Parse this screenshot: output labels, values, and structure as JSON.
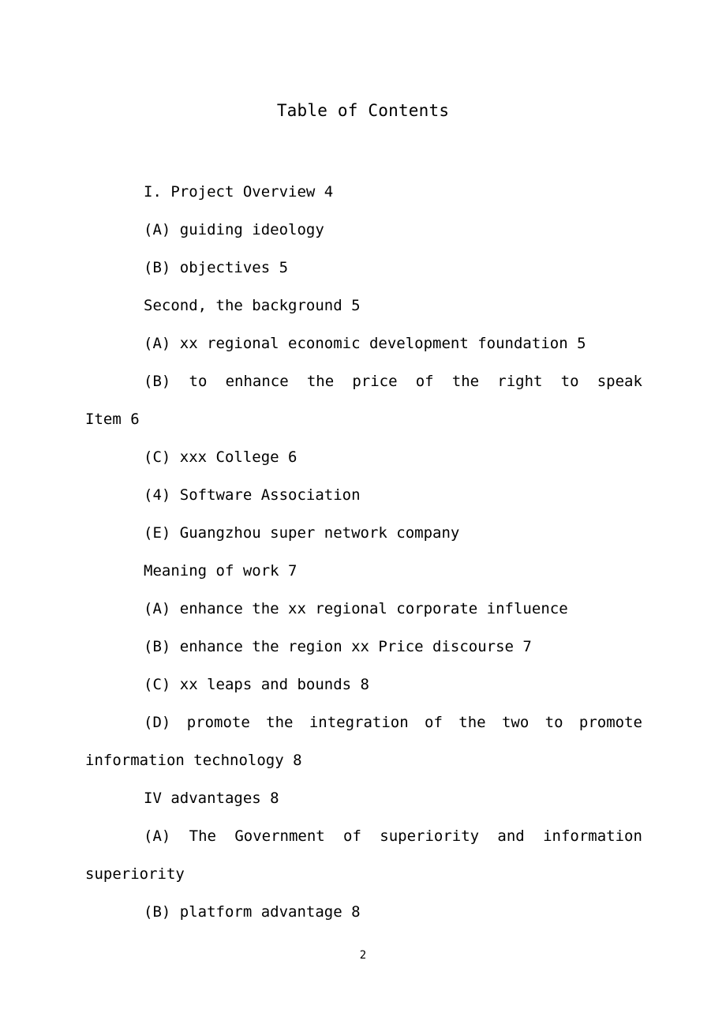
{
  "document": {
    "title": "Table of Contents",
    "page_number": "2",
    "text_color": "#000000",
    "background_color": "#ffffff"
  },
  "toc": {
    "entries": [
      {
        "id": "project-overview",
        "style": "indent",
        "text": "I. Project Overview 4"
      },
      {
        "id": "guiding-ideology",
        "style": "indent",
        "text": "(A) guiding ideology"
      },
      {
        "id": "objectives",
        "style": "indent",
        "text": "(B) objectives 5"
      },
      {
        "id": "second-the-background",
        "style": "indent",
        "text": "Second, the background 5"
      },
      {
        "id": "regional-economic-development-foundation",
        "style": "indent",
        "text": "(A) xx regional economic development foundation 5"
      },
      {
        "id": "enhance-price-right-to-speak",
        "style": "justified-wrap",
        "line1_words": [
          "(B)",
          "to",
          "enhance",
          "the",
          "price",
          "of",
          "the",
          "right",
          "to",
          "speak"
        ],
        "line2": "Item 6"
      },
      {
        "id": "xxx-college",
        "style": "indent",
        "text": "(C) xxx College 6"
      },
      {
        "id": "software-association",
        "style": "indent",
        "text": "(4) Software Association"
      },
      {
        "id": "guangzhou-super-network-company",
        "style": "indent",
        "text": "(E) Guangzhou super network company"
      },
      {
        "id": "meaning-of-work",
        "style": "indent",
        "text": "Meaning of work 7"
      },
      {
        "id": "enhance-regional-corporate-influence",
        "style": "indent",
        "text": "(A) enhance the xx regional corporate influence"
      },
      {
        "id": "enhance-region-price-discourse",
        "style": "indent",
        "text": "(B) enhance the region xx Price discourse 7"
      },
      {
        "id": "leaps-and-bounds",
        "style": "indent",
        "text": "(C) xx leaps and bounds 8"
      },
      {
        "id": "promote-integration-of-the-two",
        "style": "justified-wrap",
        "line1_words": [
          "(D)",
          "promote",
          "the",
          "integration",
          "of",
          "the",
          "two",
          "to",
          "promote"
        ],
        "line2": "information technology 8"
      },
      {
        "id": "iv-advantages",
        "style": "indent",
        "text": "IV advantages 8"
      },
      {
        "id": "government-and-information-superiority",
        "style": "justified-wrap",
        "line1_words": [
          "(A)",
          "The",
          "Government",
          "of",
          "superiority",
          "and",
          "information"
        ],
        "line2": "superiority"
      },
      {
        "id": "platform-advantage",
        "style": "indent",
        "text": "(B) platform advantage 8"
      }
    ]
  }
}
